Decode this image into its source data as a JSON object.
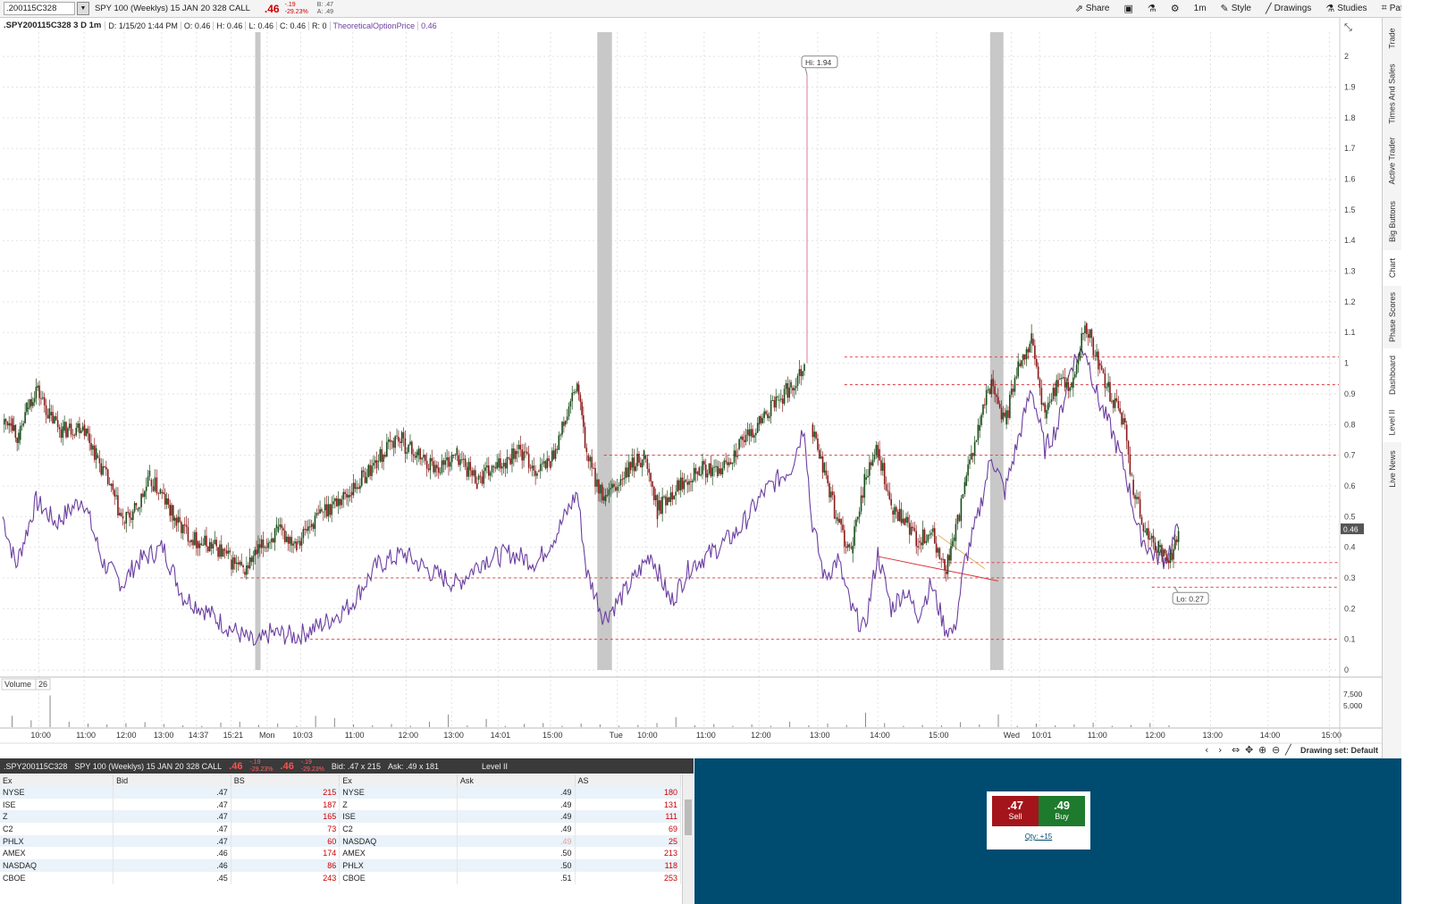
{
  "toolbar": {
    "symbol": ".200115C328",
    "description": "SPY 100 (Weeklys) 15 JAN 20 328 CALL",
    "last": ".46",
    "change": "-.19",
    "change_pct": "-29.23%",
    "bid": "B: .47",
    "ask": "A: .49",
    "buttons": [
      "Share",
      "1m",
      "Style",
      "Drawings",
      "Studies",
      "Patterns"
    ]
  },
  "chart_header": {
    "symbol": ".SPY200115C328 3 D 1m",
    "date": "D: 1/15/20 1:44 PM",
    "open": "O: 0.46",
    "high": "H: 0.46",
    "low": "L: 0.46",
    "close": "C: 0.46",
    "range": "R: 0",
    "study": "TheoreticalOptionPrice",
    "study_value": "0.46"
  },
  "right_tabs": [
    "Trade",
    "Times And Sales",
    "Active Trader",
    "Big Buttons",
    "Chart",
    "Phase Scores",
    "Dashboard",
    "Level II",
    "Live News"
  ],
  "colors": {
    "candle_up": "#1a4d1a",
    "candle_down": "#8b1a1a",
    "study_line": "#6b3fa0",
    "hline": "#d9343b",
    "session_gap": "#c8c8c8",
    "order_panel": "#004b70",
    "sell": "#a3151b",
    "buy": "#1e7a2c"
  },
  "chart_data": {
    "type": "line",
    "y_ticks": [
      "2",
      "1.9",
      "1.8",
      "1.7",
      "1.6",
      "1.5",
      "1.4",
      "1.3",
      "1.2",
      "1.1",
      "1",
      "0.9",
      "0.8",
      "0.7",
      "0.6",
      "0.5",
      "0.4",
      "0.3",
      "0.2",
      "0.1",
      "0"
    ],
    "ylim": [
      0,
      2.05
    ],
    "x_ticks": [
      "10:00",
      "11:00",
      "12:00",
      "13:00",
      "14:37",
      "15:21",
      "Mon",
      "10:03",
      "11:00",
      "12:00",
      "13:00",
      "14:01",
      "15:00",
      "Tue",
      "10:00",
      "11:00",
      "12:00",
      "13:00",
      "14:00",
      "15:00",
      "Wed",
      "10:01",
      "11:00",
      "12:00",
      "13:00",
      "14:00",
      "15:00"
    ],
    "current_price_label": "0.46",
    "hi_label": "Hi: 1.94",
    "lo_label": "Lo: 0.27",
    "volume_label": "Volume",
    "volume_value": "26",
    "volume_ticks": [
      "7,500",
      "5,000"
    ],
    "drawing_set": "Drawing set: Default",
    "horizontal_lines": [
      1.02,
      0.93,
      0.7,
      0.35,
      0.3,
      0.27,
      0.1
    ],
    "price_series": [
      {
        "x": 0,
        "y": 0.8
      },
      {
        "x": 0.006,
        "y": 0.82
      },
      {
        "x": 0.012,
        "y": 0.75
      },
      {
        "x": 0.018,
        "y": 0.85
      },
      {
        "x": 0.025,
        "y": 0.92
      },
      {
        "x": 0.035,
        "y": 0.83
      },
      {
        "x": 0.045,
        "y": 0.78
      },
      {
        "x": 0.06,
        "y": 0.8
      },
      {
        "x": 0.07,
        "y": 0.7
      },
      {
        "x": 0.08,
        "y": 0.6
      },
      {
        "x": 0.09,
        "y": 0.48
      },
      {
        "x": 0.1,
        "y": 0.52
      },
      {
        "x": 0.11,
        "y": 0.62
      },
      {
        "x": 0.118,
        "y": 0.58
      },
      {
        "x": 0.13,
        "y": 0.48
      },
      {
        "x": 0.145,
        "y": 0.42
      },
      {
        "x": 0.16,
        "y": 0.4
      },
      {
        "x": 0.17,
        "y": 0.36
      },
      {
        "x": 0.18,
        "y": 0.32
      },
      {
        "x": 0.19,
        "y": 0.38
      },
      {
        "x": 0.205,
        "y": 0.45
      },
      {
        "x": 0.22,
        "y": 0.42
      },
      {
        "x": 0.24,
        "y": 0.52
      },
      {
        "x": 0.26,
        "y": 0.58
      },
      {
        "x": 0.28,
        "y": 0.68
      },
      {
        "x": 0.295,
        "y": 0.76
      },
      {
        "x": 0.31,
        "y": 0.7
      },
      {
        "x": 0.325,
        "y": 0.66
      },
      {
        "x": 0.34,
        "y": 0.7
      },
      {
        "x": 0.355,
        "y": 0.62
      },
      {
        "x": 0.37,
        "y": 0.66
      },
      {
        "x": 0.385,
        "y": 0.72
      },
      {
        "x": 0.4,
        "y": 0.65
      },
      {
        "x": 0.41,
        "y": 0.68
      },
      {
        "x": 0.42,
        "y": 0.8
      },
      {
        "x": 0.43,
        "y": 0.93
      },
      {
        "x": 0.437,
        "y": 0.7
      },
      {
        "x": 0.45,
        "y": 0.55
      },
      {
        "x": 0.46,
        "y": 0.6
      },
      {
        "x": 0.47,
        "y": 0.66
      },
      {
        "x": 0.48,
        "y": 0.7
      },
      {
        "x": 0.49,
        "y": 0.52
      },
      {
        "x": 0.5,
        "y": 0.58
      },
      {
        "x": 0.51,
        "y": 0.62
      },
      {
        "x": 0.52,
        "y": 0.66
      },
      {
        "x": 0.535,
        "y": 0.64
      },
      {
        "x": 0.55,
        "y": 0.72
      },
      {
        "x": 0.565,
        "y": 0.8
      },
      {
        "x": 0.58,
        "y": 0.88
      },
      {
        "x": 0.59,
        "y": 0.92
      },
      {
        "x": 0.6,
        "y": 1.0
      },
      {
        "x": 0.602,
        "y": 1.94
      },
      {
        "x": 0.605,
        "y": 0.8
      },
      {
        "x": 0.615,
        "y": 0.65
      },
      {
        "x": 0.625,
        "y": 0.48
      },
      {
        "x": 0.635,
        "y": 0.38
      },
      {
        "x": 0.645,
        "y": 0.62
      },
      {
        "x": 0.655,
        "y": 0.72
      },
      {
        "x": 0.665,
        "y": 0.52
      },
      {
        "x": 0.675,
        "y": 0.48
      },
      {
        "x": 0.685,
        "y": 0.42
      },
      {
        "x": 0.695,
        "y": 0.45
      },
      {
        "x": 0.705,
        "y": 0.32
      },
      {
        "x": 0.712,
        "y": 0.42
      },
      {
        "x": 0.72,
        "y": 0.6
      },
      {
        "x": 0.73,
        "y": 0.78
      },
      {
        "x": 0.74,
        "y": 0.95
      },
      {
        "x": 0.75,
        "y": 0.8
      },
      {
        "x": 0.76,
        "y": 1.0
      },
      {
        "x": 0.77,
        "y": 1.08
      },
      {
        "x": 0.78,
        "y": 0.82
      },
      {
        "x": 0.79,
        "y": 0.95
      },
      {
        "x": 0.8,
        "y": 0.92
      },
      {
        "x": 0.81,
        "y": 1.13
      },
      {
        "x": 0.82,
        "y": 1.0
      },
      {
        "x": 0.83,
        "y": 0.88
      },
      {
        "x": 0.84,
        "y": 0.8
      },
      {
        "x": 0.845,
        "y": 0.62
      },
      {
        "x": 0.855,
        "y": 0.44
      },
      {
        "x": 0.865,
        "y": 0.4
      },
      {
        "x": 0.875,
        "y": 0.36
      },
      {
        "x": 0.88,
        "y": 0.46
      }
    ],
    "study_series": [
      {
        "x": 0,
        "y": 0.5
      },
      {
        "x": 0.01,
        "y": 0.34
      },
      {
        "x": 0.025,
        "y": 0.55
      },
      {
        "x": 0.04,
        "y": 0.48
      },
      {
        "x": 0.06,
        "y": 0.56
      },
      {
        "x": 0.075,
        "y": 0.35
      },
      {
        "x": 0.09,
        "y": 0.28
      },
      {
        "x": 0.1,
        "y": 0.35
      },
      {
        "x": 0.12,
        "y": 0.4
      },
      {
        "x": 0.135,
        "y": 0.24
      },
      {
        "x": 0.15,
        "y": 0.2
      },
      {
        "x": 0.165,
        "y": 0.15
      },
      {
        "x": 0.18,
        "y": 0.11
      },
      {
        "x": 0.19,
        "y": 0.08
      },
      {
        "x": 0.2,
        "y": 0.12
      },
      {
        "x": 0.22,
        "y": 0.11
      },
      {
        "x": 0.24,
        "y": 0.15
      },
      {
        "x": 0.26,
        "y": 0.21
      },
      {
        "x": 0.28,
        "y": 0.34
      },
      {
        "x": 0.3,
        "y": 0.38
      },
      {
        "x": 0.32,
        "y": 0.32
      },
      {
        "x": 0.34,
        "y": 0.28
      },
      {
        "x": 0.36,
        "y": 0.36
      },
      {
        "x": 0.38,
        "y": 0.38
      },
      {
        "x": 0.4,
        "y": 0.35
      },
      {
        "x": 0.415,
        "y": 0.45
      },
      {
        "x": 0.43,
        "y": 0.58
      },
      {
        "x": 0.437,
        "y": 0.32
      },
      {
        "x": 0.45,
        "y": 0.17
      },
      {
        "x": 0.46,
        "y": 0.22
      },
      {
        "x": 0.47,
        "y": 0.28
      },
      {
        "x": 0.485,
        "y": 0.38
      },
      {
        "x": 0.5,
        "y": 0.22
      },
      {
        "x": 0.515,
        "y": 0.34
      },
      {
        "x": 0.53,
        "y": 0.38
      },
      {
        "x": 0.55,
        "y": 0.45
      },
      {
        "x": 0.57,
        "y": 0.58
      },
      {
        "x": 0.59,
        "y": 0.66
      },
      {
        "x": 0.6,
        "y": 0.8
      },
      {
        "x": 0.605,
        "y": 0.5
      },
      {
        "x": 0.615,
        "y": 0.3
      },
      {
        "x": 0.625,
        "y": 0.36
      },
      {
        "x": 0.635,
        "y": 0.2
      },
      {
        "x": 0.645,
        "y": 0.13
      },
      {
        "x": 0.655,
        "y": 0.38
      },
      {
        "x": 0.665,
        "y": 0.2
      },
      {
        "x": 0.675,
        "y": 0.26
      },
      {
        "x": 0.685,
        "y": 0.18
      },
      {
        "x": 0.695,
        "y": 0.28
      },
      {
        "x": 0.705,
        "y": 0.14
      },
      {
        "x": 0.712,
        "y": 0.12
      },
      {
        "x": 0.72,
        "y": 0.35
      },
      {
        "x": 0.73,
        "y": 0.5
      },
      {
        "x": 0.74,
        "y": 0.7
      },
      {
        "x": 0.75,
        "y": 0.58
      },
      {
        "x": 0.76,
        "y": 0.75
      },
      {
        "x": 0.77,
        "y": 0.92
      },
      {
        "x": 0.78,
        "y": 0.72
      },
      {
        "x": 0.79,
        "y": 0.8
      },
      {
        "x": 0.8,
        "y": 1.0
      },
      {
        "x": 0.81,
        "y": 1.05
      },
      {
        "x": 0.82,
        "y": 0.88
      },
      {
        "x": 0.83,
        "y": 0.78
      },
      {
        "x": 0.84,
        "y": 0.65
      },
      {
        "x": 0.85,
        "y": 0.45
      },
      {
        "x": 0.86,
        "y": 0.38
      },
      {
        "x": 0.87,
        "y": 0.36
      },
      {
        "x": 0.88,
        "y": 0.46
      }
    ],
    "volume_series": [
      2500,
      1500,
      7000,
      1200,
      800,
      600,
      900,
      1100,
      700,
      400,
      300,
      1000,
      1200,
      500,
      800,
      300,
      2500,
      2000,
      600,
      400,
      700,
      300,
      1200,
      2800,
      400,
      1800,
      300,
      700,
      900,
      300,
      800,
      600,
      300,
      500,
      900,
      2200,
      400,
      700,
      300,
      600,
      300,
      1200,
      400,
      800,
      500,
      3200,
      900,
      300,
      500,
      400,
      1100,
      600,
      2800,
      300,
      800,
      400,
      600,
      1000,
      300,
      500,
      900,
      400
    ]
  },
  "level2": {
    "symbol": ".SPY200115C328",
    "description": "SPY 100 (Weeklys) 15 JAN 20 328 CALL",
    "last": ".46",
    "change": "-.19",
    "change_pct": "-29.23%",
    "last2": ".46",
    "change2": "-.19",
    "change_pct2": "-29.23%",
    "bid": "Bid: .47 x 215",
    "ask": "Ask: .49 x 181",
    "title": "Level II",
    "columns": [
      "Ex",
      "Bid",
      "BS",
      "Ex",
      "Ask",
      "AS"
    ],
    "rows": [
      {
        "bex": "NYSE",
        "bid": ".47",
        "bs": "215",
        "aex": "NYSE",
        "ask": ".49",
        "as": "180"
      },
      {
        "bex": "ISE",
        "bid": ".47",
        "bs": "187",
        "aex": "Z",
        "ask": ".49",
        "as": "131"
      },
      {
        "bex": "Z",
        "bid": ".47",
        "bs": "165",
        "aex": "ISE",
        "ask": ".49",
        "as": "111"
      },
      {
        "bex": "C2",
        "bid": ".47",
        "bs": "73",
        "aex": "C2",
        "ask": ".49",
        "as": "69"
      },
      {
        "bex": "PHLX",
        "bid": ".47",
        "bs": "60",
        "aex": "NASDAQ",
        "ask": ".49",
        "as": "25"
      },
      {
        "bex": "AMEX",
        "bid": ".46",
        "bs": "174",
        "aex": "AMEX",
        "ask": ".50",
        "as": "213"
      },
      {
        "bex": "NASDAQ",
        "bid": ".46",
        "bs": "86",
        "aex": "PHLX",
        "ask": ".50",
        "as": "118"
      },
      {
        "bex": "CBOE",
        "bid": ".45",
        "bs": "243",
        "aex": "CBOE",
        "ask": ".51",
        "as": "253"
      }
    ]
  },
  "order": {
    "sell_price": ".47",
    "sell_label": "Sell",
    "buy_price": ".49",
    "buy_label": "Buy",
    "qty": "Qty: +15"
  }
}
